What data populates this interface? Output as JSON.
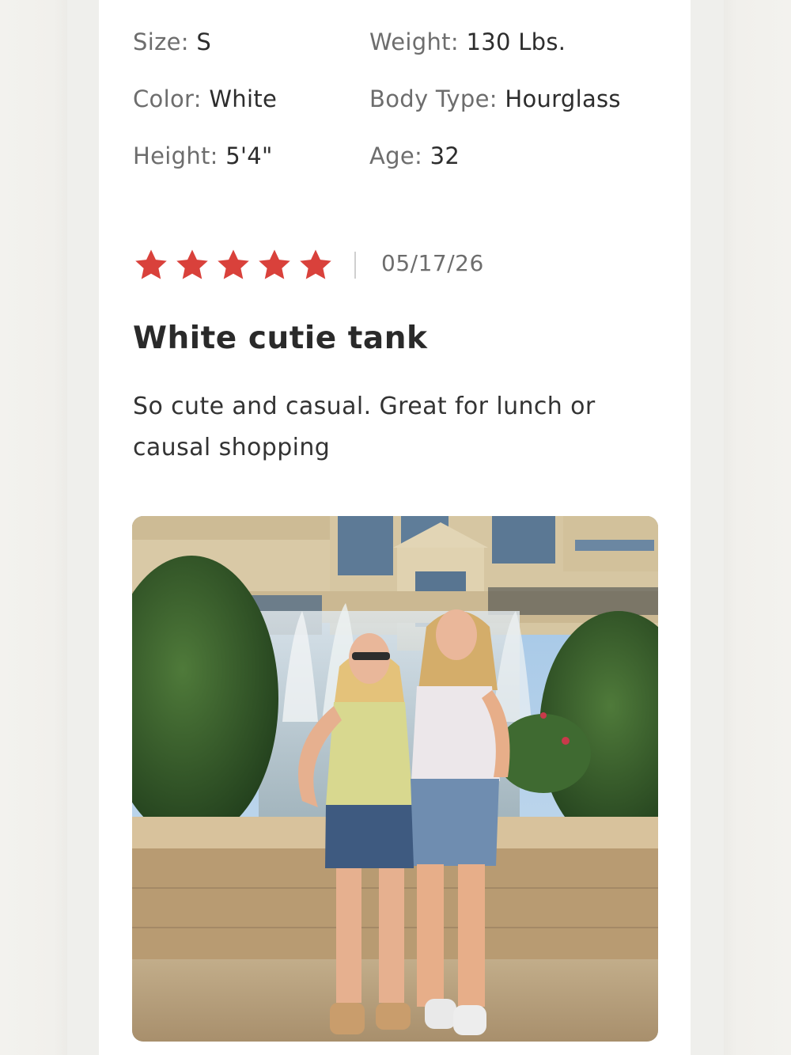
{
  "review": {
    "attributes": {
      "size_label": "Size:",
      "size_value": "S",
      "weight_label": "Weight:",
      "weight_value": "130 Lbs.",
      "color_label": "Color:",
      "color_value": "White",
      "body_type_label": "Body Type:",
      "body_type_value": "Hourglass",
      "height_label": "Height:",
      "height_value": "5'4\"",
      "age_label": "Age:",
      "age_value": "32"
    },
    "rating": 5,
    "rating_max": 5,
    "star_color": "#d9413b",
    "date": "05/17/26",
    "title": "White cutie tank",
    "body": "So cute and casual. Great for lunch or causal shopping",
    "photo_icon": "review-photo"
  }
}
